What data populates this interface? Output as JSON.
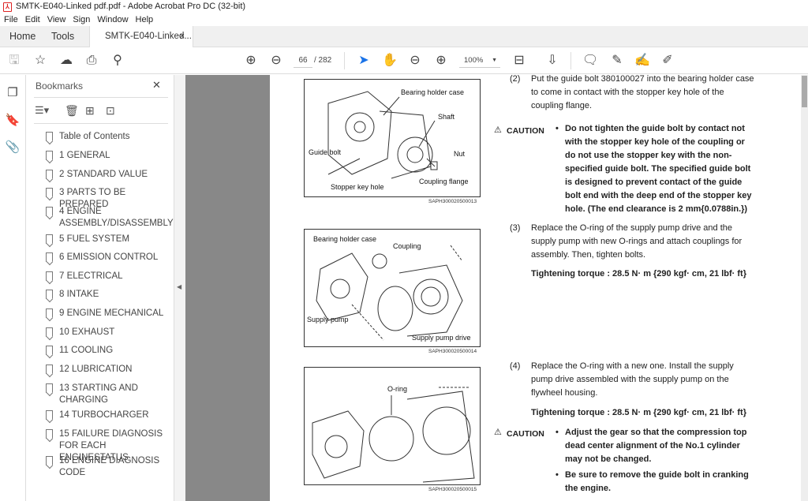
{
  "window": {
    "title": "SMTK-E040-Linked pdf.pdf - Adobe Acrobat Pro DC (32-bit)"
  },
  "menu": [
    "File",
    "Edit",
    "View",
    "Sign",
    "Window",
    "Help"
  ],
  "tabs": {
    "home": "Home",
    "tools": "Tools",
    "document": "SMTK-E040-Linked...",
    "close": "×"
  },
  "toolbar": {
    "page_current": "66",
    "page_total": "/ 282",
    "zoom": "100%"
  },
  "bookmarks": {
    "title": "Bookmarks",
    "close": "✕",
    "items": [
      "Table of Contents",
      "1 GENERAL",
      "2 STANDARD VALUE",
      "3 PARTS TO BE PREPARED",
      "4 ENGINE ASSEMBLY/DISASSEMBLY",
      "5 FUEL SYSTEM",
      "6 EMISSION CONTROL",
      "7 ELECTRICAL",
      "8 INTAKE",
      "9 ENGINE MECHANICAL",
      "10 EXHAUST",
      "11 COOLING",
      "12 LUBRICATION",
      "13 STARTING AND CHARGING",
      "14 TURBOCHARGER",
      "15 FAILURE DIAGNOSIS FOR EACH ENGINESTATUS",
      "16 ENGINE DIAGNOSIS CODE"
    ]
  },
  "document": {
    "figures": [
      {
        "caption": "SAPH300020500013",
        "labels": [
          "Bearing holder case",
          "Shaft",
          "Guide bolt",
          "Nut",
          "Coupling flange",
          "Stopper key hole"
        ]
      },
      {
        "caption": "SAPH300020500014",
        "labels": [
          "Bearing holder case",
          "Coupling",
          "Supply pump",
          "Supply pump drive"
        ]
      },
      {
        "caption": "SAPH300020500015",
        "labels": [
          "O-ring"
        ]
      }
    ],
    "step2": {
      "num": "(2)",
      "lines": [
        "Put the guide bolt 380100027 into the bearing holder case",
        "to come in contact with the stopper key hole of the",
        "coupling flange."
      ]
    },
    "caution1": {
      "label": "CAUTION",
      "lines": [
        "Do not tighten the guide bolt by contact not",
        "with the stopper key hole of the coupling or",
        "do not use the stopper key with the non-",
        "specified guide bolt.  The specified guide bolt",
        "is designed to prevent contact of the guide",
        "bolt end with the deep end of the stopper key",
        "hole. (The end clearance is 2 mm{0.0788in.})"
      ]
    },
    "step3": {
      "num": "(3)",
      "lines": [
        "Replace the O-ring of the supply pump drive and the",
        "supply pump with new O-rings and attach couplings for",
        "assembly. Then,  tighten bolts."
      ],
      "torque": "Tightening torque : 28.5 N· m {290 kgf· cm, 21 lbf· ft}"
    },
    "step4": {
      "num": "(4)",
      "lines": [
        "Replace the O-ring with a new one. Install the supply",
        "pump drive assembled with the supply pump on the",
        "flywheel housing."
      ],
      "torque": "Tightening torque : 28.5 N· m {290 kgf· cm, 21 lbf· ft}"
    },
    "caution2": {
      "label": "CAUTION",
      "bullets": [
        [
          "Adjust the gear so that the compression top",
          "dead center alignment of the No.1 cylinder",
          "may not be changed."
        ],
        [
          "Be sure to remove the guide bolt in cranking",
          "the engine."
        ]
      ]
    }
  }
}
